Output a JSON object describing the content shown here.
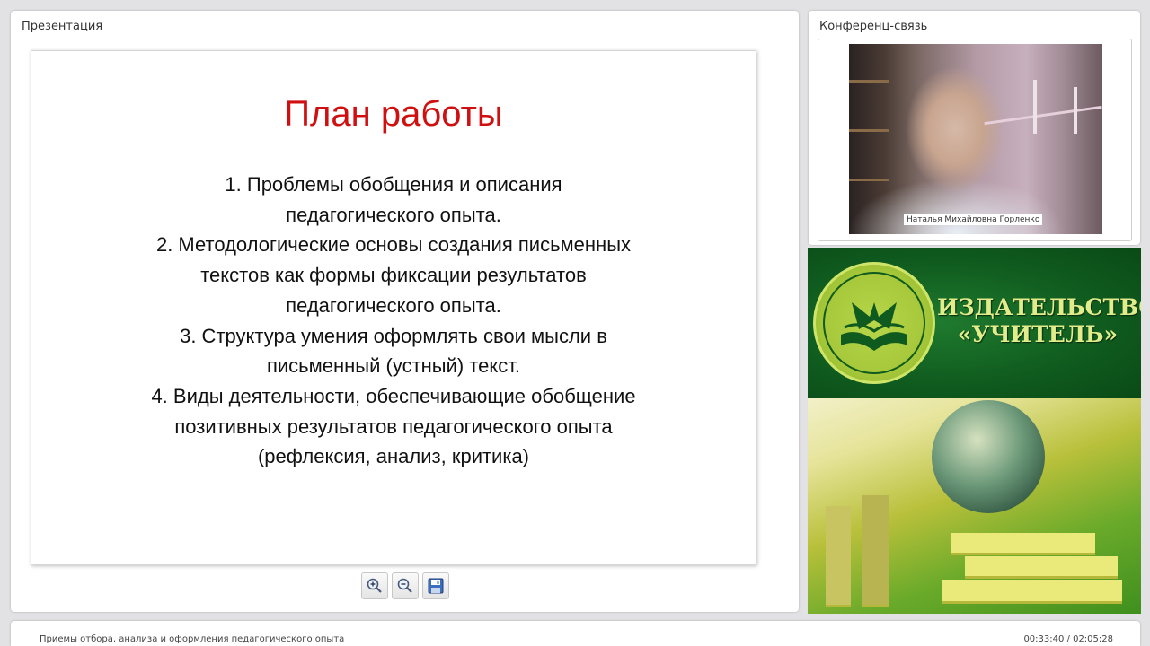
{
  "presentation": {
    "panel_title": "Презентация",
    "slide": {
      "title": "План работы",
      "items": [
        "1. Проблемы обобщения и описания",
        "педагогического опыта.",
        "2. Методологические основы создания письменных",
        "текстов как формы фиксации результатов",
        "педагогического опыта.",
        "3. Структура умения оформлять свои мысли в",
        "письменный (устный) текст.",
        "4. Виды деятельности, обеспечивающие обобщение",
        "позитивных результатов педагогического опыта",
        "(рефлексия, анализ, критика)"
      ]
    },
    "toolbar": {
      "zoom_in_icon": "zoom-in-icon",
      "zoom_out_icon": "zoom-out-icon",
      "save_icon": "floppy-disk-icon"
    }
  },
  "conference": {
    "panel_title": "Конференц-связь",
    "speaker_name": "Наталья Михайловна Горленко"
  },
  "banner": {
    "line1": "ИЗДАТЕЛЬСТВО",
    "line2": "«УЧИТЕЛЬ»",
    "colors": {
      "green": "#0f5a1e",
      "lime": "#cfe56a"
    }
  },
  "status": {
    "recording_title": "Приемы отбора, анализа и оформления педагогического опыта",
    "time": "00:33:40 / 02:05:28"
  }
}
